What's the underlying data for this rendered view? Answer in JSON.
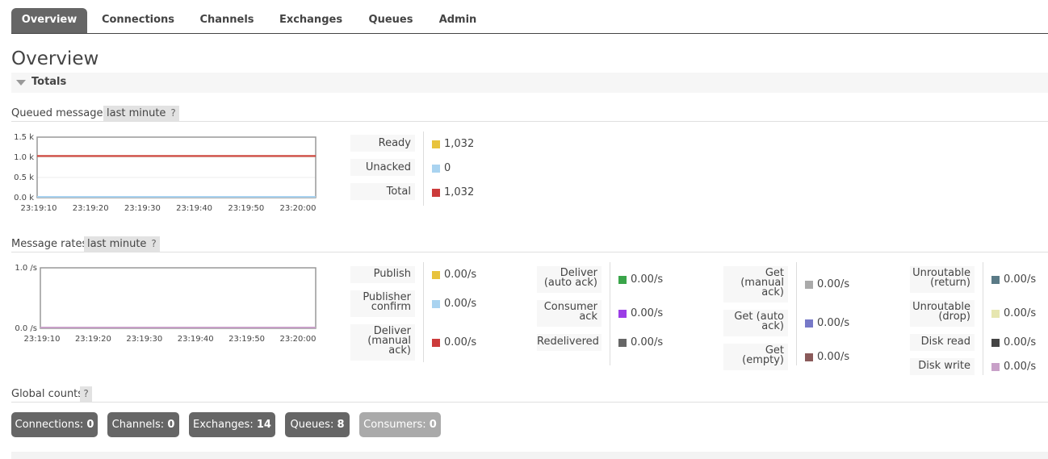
{
  "nav": {
    "tabs": [
      {
        "label": "Overview"
      },
      {
        "label": "Connections"
      },
      {
        "label": "Channels"
      },
      {
        "label": "Exchanges"
      },
      {
        "label": "Queues"
      },
      {
        "label": "Admin"
      }
    ]
  },
  "page": {
    "title": "Overview",
    "section": "Totals"
  },
  "queued": {
    "label": "Queued messages",
    "range": "last minute",
    "help": "?",
    "legend": [
      {
        "label": "Ready",
        "value": "1,032",
        "color": "#e8c33d"
      },
      {
        "label": "Unacked",
        "value": "0",
        "color": "#a9d3f0"
      },
      {
        "label": "Total",
        "value": "1,032",
        "color": "#cc3b3b"
      }
    ]
  },
  "rates": {
    "label": "Message rates",
    "range": "last minute",
    "help": "?",
    "col1": [
      {
        "l1": "Publish",
        "l2": "",
        "l3": "",
        "value": "0.00/s",
        "color": "#e8c33d"
      },
      {
        "l1": "Publisher",
        "l2": "confirm",
        "l3": "",
        "value": "0.00/s",
        "color": "#a9d3f0"
      },
      {
        "l1": "Deliver",
        "l2": "(manual",
        "l3": "ack)",
        "value": "0.00/s",
        "color": "#cc3b3b"
      }
    ],
    "col2": [
      {
        "l1": "Deliver",
        "l2": "(auto ack)",
        "l3": "",
        "value": "0.00/s",
        "color": "#3aa54a"
      },
      {
        "l1": "Consumer",
        "l2": "ack",
        "l3": "",
        "value": "0.00/s",
        "color": "#9b3de6"
      },
      {
        "l1": "Redelivered",
        "l2": "",
        "l3": "",
        "value": "0.00/s",
        "color": "#666666"
      }
    ],
    "col3": [
      {
        "l1": "Get",
        "l2": "(manual",
        "l3": "ack)",
        "value": "0.00/s",
        "color": "#aaaaaa"
      },
      {
        "l1": "Get (auto",
        "l2": "ack)",
        "l3": "",
        "value": "0.00/s",
        "color": "#7779c8"
      },
      {
        "l1": "Get",
        "l2": "(empty)",
        "l3": "",
        "value": "0.00/s",
        "color": "#8a5a5a"
      }
    ],
    "col4": [
      {
        "l1": "Unroutable",
        "l2": "(return)",
        "l3": "",
        "value": "0.00/s",
        "color": "#5a7a86"
      },
      {
        "l1": "Unroutable",
        "l2": "(drop)",
        "l3": "",
        "value": "0.00/s",
        "color": "#e6e6b0"
      },
      {
        "l1": "Disk read",
        "l2": "",
        "l3": "",
        "value": "0.00/s",
        "color": "#444444"
      },
      {
        "l1": "Disk write",
        "l2": "",
        "l3": "",
        "value": "0.00/s",
        "color": "#c8a0c8"
      }
    ]
  },
  "global": {
    "label": "Global counts",
    "help": "?",
    "counts": [
      {
        "label": "Connections:",
        "value": "0"
      },
      {
        "label": "Channels:",
        "value": "0"
      },
      {
        "label": "Exchanges:",
        "value": "14"
      },
      {
        "label": "Queues:",
        "value": "8"
      },
      {
        "label": "Consumers:",
        "value": "0"
      }
    ]
  },
  "charts": [
    {
      "type": "line",
      "x": [
        "23:19:10",
        "23:19:20",
        "23:19:30",
        "23:19:40",
        "23:19:50",
        "23:20:00"
      ],
      "y_ticks": [
        "1.5 k",
        "1.0 k",
        "0.5 k",
        "0.0 k"
      ],
      "ylim": [
        0,
        1500
      ],
      "series": [
        {
          "name": "Ready",
          "color": "#e8c33d",
          "values": [
            1032,
            1032,
            1032,
            1032,
            1032,
            1032
          ]
        },
        {
          "name": "Unacked",
          "color": "#a9d3f0",
          "values": [
            0,
            0,
            0,
            0,
            0,
            0
          ]
        },
        {
          "name": "Total",
          "color": "#cc3b3b",
          "values": [
            1032,
            1032,
            1032,
            1032,
            1032,
            1032
          ]
        }
      ]
    },
    {
      "type": "line",
      "x": [
        "23:19:10",
        "23:19:20",
        "23:19:30",
        "23:19:40",
        "23:19:50",
        "23:20:00"
      ],
      "y_ticks": [
        "1.0 /s",
        "0.0 /s"
      ],
      "ylim": [
        0,
        1
      ],
      "series": [
        {
          "name": "Publish",
          "color": "#c8a0c8",
          "values": [
            0,
            0,
            0,
            0,
            0,
            0
          ]
        }
      ]
    }
  ]
}
